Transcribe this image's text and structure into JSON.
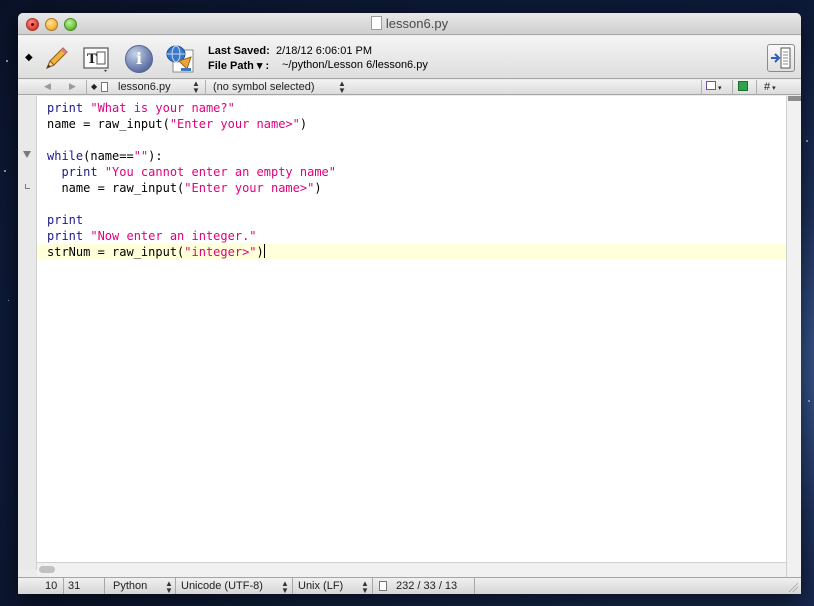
{
  "window": {
    "title": "lesson6.py"
  },
  "toolbar": {
    "last_saved_label": "Last Saved:",
    "last_saved_value": "2/18/12 6:06:01 PM",
    "file_path_label": "File Path ▾ :",
    "file_path_value": "~/python/Lesson 6/lesson6.py"
  },
  "navbar": {
    "file_name": "lesson6.py",
    "symbol": "(no symbol selected)",
    "counterpart": "#"
  },
  "code": {
    "lines": [
      [
        {
          "t": "print",
          "c": "kw"
        },
        {
          "t": " "
        },
        {
          "t": "\"What is your name?\"",
          "c": "str"
        }
      ],
      [
        {
          "t": "name = raw_input("
        },
        {
          "t": "\"Enter your name>\"",
          "c": "str"
        },
        {
          "t": ")"
        }
      ],
      [],
      [
        {
          "t": "while",
          "c": "kw"
        },
        {
          "t": "(name=="
        },
        {
          "t": "\"\"",
          "c": "str"
        },
        {
          "t": "):"
        }
      ],
      [
        {
          "t": "  "
        },
        {
          "t": "print",
          "c": "kw"
        },
        {
          "t": " "
        },
        {
          "t": "\"You cannot enter an empty name\"",
          "c": "str"
        }
      ],
      [
        {
          "t": "  name = raw_input("
        },
        {
          "t": "\"Enter your name>\"",
          "c": "str"
        },
        {
          "t": ")"
        }
      ],
      [],
      [
        {
          "t": "print",
          "c": "kw"
        }
      ],
      [
        {
          "t": "print",
          "c": "kw"
        },
        {
          "t": " "
        },
        {
          "t": "\"Now enter an integer.\"",
          "c": "str"
        }
      ],
      [
        {
          "t": "strNum = raw_input("
        },
        {
          "t": "\"integer>\"",
          "c": "str"
        },
        {
          "t": ")"
        }
      ]
    ],
    "current_line": 10,
    "colors": {
      "keyword": "#1a1a8c",
      "string": "#e0007e",
      "identifier": "#000000",
      "current_line_bg": "#ffffd9"
    }
  },
  "statusbar": {
    "line": "10",
    "column": "31",
    "language": "Python",
    "encoding": "Unicode (UTF-8)",
    "line_endings": "Unix (LF)",
    "stats": "232 / 33 / 13"
  }
}
